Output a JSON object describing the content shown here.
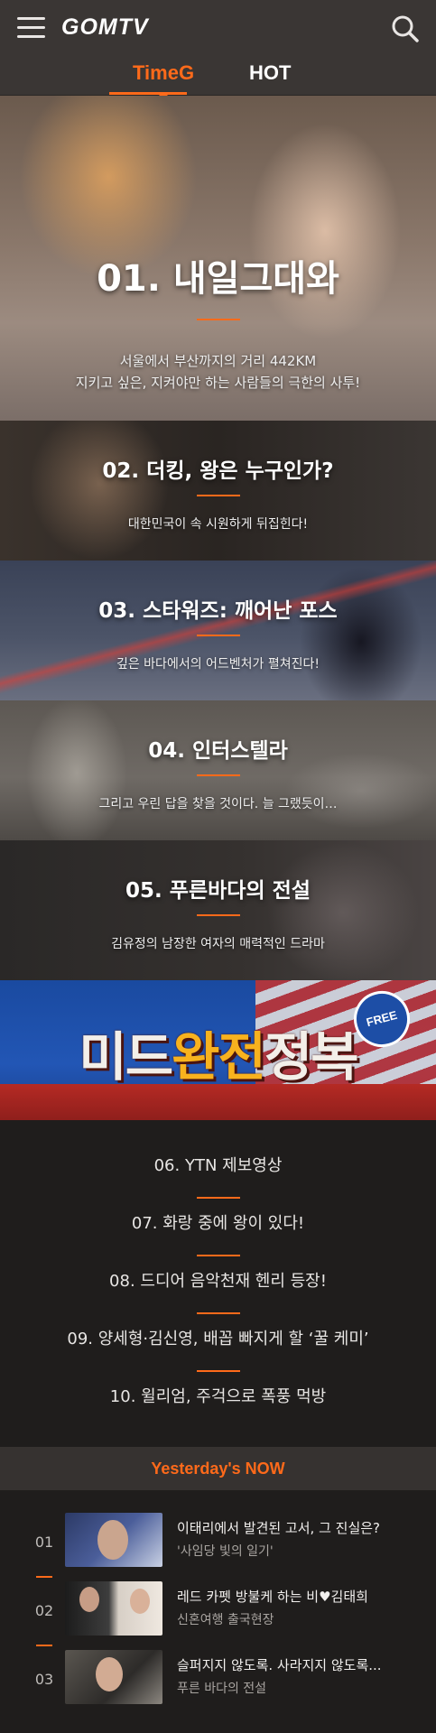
{
  "header": {
    "logo": "GOMTV",
    "menu_icon": "hamburger-menu-icon",
    "search_icon": "search-icon"
  },
  "tabs": [
    {
      "label": "TimeG",
      "active": true
    },
    {
      "label": "HOT",
      "active": false
    }
  ],
  "features": [
    {
      "title": "01. 내일그대와",
      "desc_line1": "서울에서 부산까지의 거리 442KM",
      "desc_line2": "지키고 싶은, 지켜야만 하는 사람들의 극한의 사투!"
    },
    {
      "title": "02. 더킹, 왕은 누구인가?",
      "desc": "대한민국이 속 시원하게 뒤집힌다!"
    },
    {
      "title": "03. 스타워즈: 깨어난 포스",
      "desc": "깊은 바다에서의 어드벤처가 펼쳐진다!"
    },
    {
      "title": "04. 인터스텔라",
      "desc": "그리고 우린 답을 찾을 것이다. 늘 그랬듯이…"
    },
    {
      "title": "05. 푸른바다의 전설",
      "desc": "김유정의 남장한 여자의 매력적인 드라마"
    }
  ],
  "banner": {
    "text_a": "미드",
    "text_b": "완전",
    "text_c": "정복",
    "badge": "FREE"
  },
  "ranklist": [
    {
      "label": "06. YTN 제보영상"
    },
    {
      "label": "07. 화랑 중에 왕이 있다!"
    },
    {
      "label": "08. 드디어 음악천재 헨리 등장!"
    },
    {
      "label": "09. 양세형·김신영, 배꼽 빠지게 할 ‘꿀 케미’"
    },
    {
      "label": "10. 윌리엄, 주걱으로 폭풍 먹방"
    }
  ],
  "yesterday": {
    "heading": "Yesterday's NOW",
    "items": [
      {
        "num": "01",
        "title": "이태리에서 발견된 고서, 그 진실은?",
        "sub": "'사임당 빛의 일기'"
      },
      {
        "num": "02",
        "title": "레드 카펫 방불케 하는 비♥김태희",
        "sub": "신혼여행 출국현장"
      },
      {
        "num": "03",
        "title": "슬퍼지지 않도록. 사라지지 않도록...",
        "sub": "푸른 바다의 전설"
      }
    ]
  },
  "colors": {
    "accent": "#ff6a1a",
    "topbar": "#3a3634",
    "background": "#1f1d1c"
  }
}
